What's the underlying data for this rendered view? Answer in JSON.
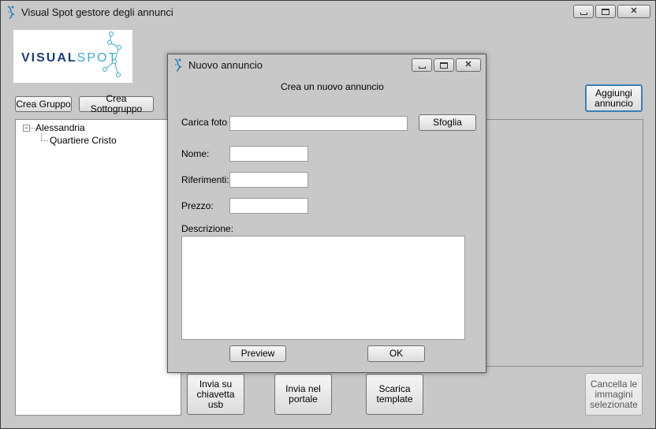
{
  "main_window": {
    "title": "Visual Spot gestore degli annunci",
    "logo": {
      "word_visual": "VISUAL",
      "word_spot": "SPOT"
    },
    "buttons": {
      "crea_gruppo": "Crea Gruppo",
      "crea_sottogruppo": "Crea Sottogruppo",
      "aggiungi_annuncio": "Aggiungi annuncio",
      "invia_usb": "Invia su chiavetta usb",
      "invia_portale": "Invia nel portale",
      "scarica_template": "Scarica template",
      "cancella_immagini": "Cancella le immagini selezionate"
    },
    "tree": {
      "root": "Alessandria",
      "child": "Quartiere Cristo",
      "expander": "−"
    }
  },
  "dialog": {
    "title": "Nuovo annuncio",
    "heading": "Crea un nuovo annuncio",
    "labels": {
      "carica_foto": "Carica foto",
      "nome": "Nome:",
      "riferimenti": "Riferimenti:",
      "prezzo": "Prezzo:",
      "descrizione": "Descrizione:"
    },
    "values": {
      "carica_foto": "",
      "nome": "",
      "riferimenti": "",
      "prezzo": "",
      "descrizione": ""
    },
    "buttons": {
      "sfoglia": "Sfoglia",
      "preview": "Preview",
      "ok": "OK"
    }
  },
  "icons": {
    "app": "visual-spot-app-icon",
    "minimize": "minimize-icon",
    "maximize": "maximize-icon",
    "close": "close-icon"
  },
  "colors": {
    "window_bg": "#c8c8c8",
    "focus_border": "#3c7fb1",
    "logo_blue": "#1c3c7c",
    "logo_cyan": "#3aa9d6"
  }
}
